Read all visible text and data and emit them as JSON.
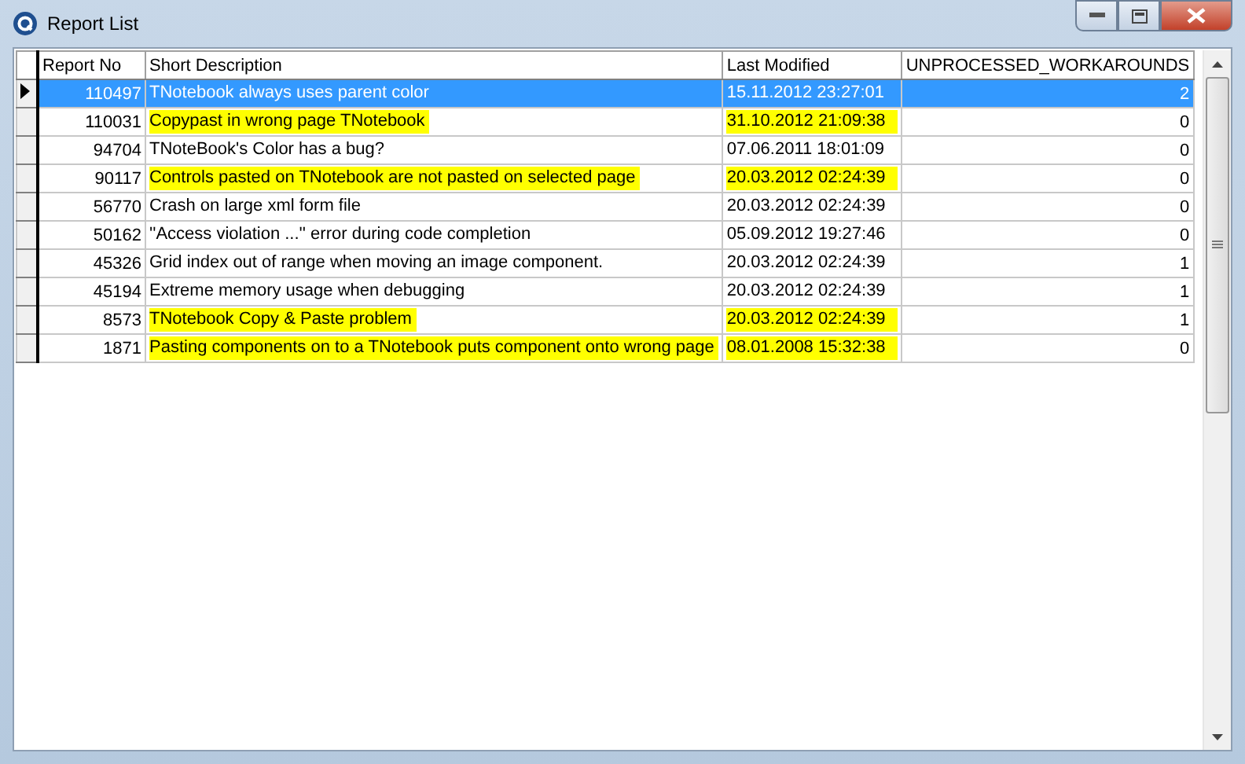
{
  "window": {
    "title": "Report List"
  },
  "table": {
    "columns": [
      "Report No",
      "Short Description",
      "Last Modified",
      "UNPROCESSED_WORKAROUNDS"
    ],
    "rows": [
      {
        "report_no": "110497",
        "description": "TNotebook always uses parent color",
        "last_modified": "15.11.2012 23:27:01",
        "workarounds": "2",
        "selected": true,
        "highlighted": false
      },
      {
        "report_no": "110031",
        "description": "Copypast in wrong page TNotebook",
        "last_modified": "31.10.2012 21:09:38",
        "workarounds": "0",
        "selected": false,
        "highlighted": true
      },
      {
        "report_no": "94704",
        "description": "TNoteBook's Color has a bug?",
        "last_modified": "07.06.2011 18:01:09",
        "workarounds": "0",
        "selected": false,
        "highlighted": false
      },
      {
        "report_no": "90117",
        "description": "Controls pasted on TNotebook are not pasted on selected page",
        "last_modified": "20.03.2012 02:24:39",
        "workarounds": "0",
        "selected": false,
        "highlighted": true
      },
      {
        "report_no": "56770",
        "description": "Crash on large xml form file",
        "last_modified": "20.03.2012 02:24:39",
        "workarounds": "0",
        "selected": false,
        "highlighted": false
      },
      {
        "report_no": "50162",
        "description": "''Access violation ...'' error during code completion",
        "last_modified": "05.09.2012 19:27:46",
        "workarounds": "0",
        "selected": false,
        "highlighted": false
      },
      {
        "report_no": "45326",
        "description": "Grid index out of range when moving an image component.",
        "last_modified": "20.03.2012 02:24:39",
        "workarounds": "1",
        "selected": false,
        "highlighted": false
      },
      {
        "report_no": "45194",
        "description": "Extreme memory usage when debugging",
        "last_modified": "20.03.2012 02:24:39",
        "workarounds": "1",
        "selected": false,
        "highlighted": false
      },
      {
        "report_no": "8573",
        "description": "TNotebook Copy & Paste problem",
        "last_modified": "20.03.2012 02:24:39",
        "workarounds": "1",
        "selected": false,
        "highlighted": true
      },
      {
        "report_no": "1871",
        "description": "Pasting components on to a TNotebook puts component onto wrong page",
        "last_modified": "08.01.2008 15:32:38",
        "workarounds": "0",
        "selected": false,
        "highlighted": true
      }
    ]
  }
}
